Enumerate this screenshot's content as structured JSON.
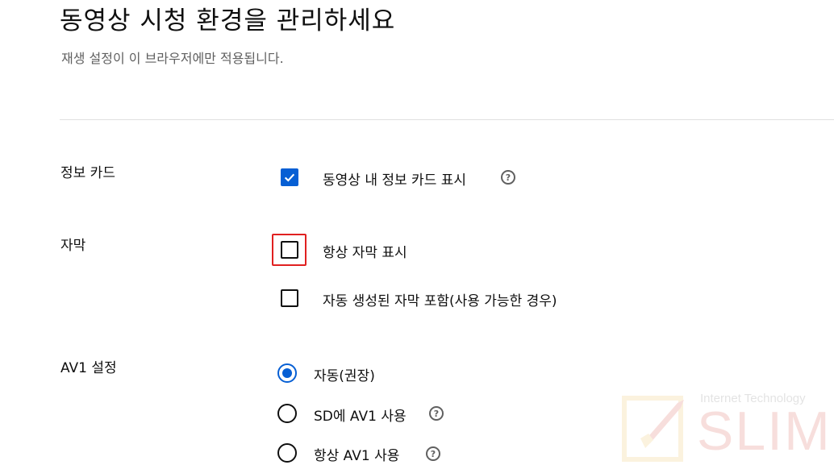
{
  "header": {
    "title": "동영상 시청 환경을 관리하세요",
    "subtitle": "재생 설정이 이 브라우저에만 적용됩니다."
  },
  "info_cards": {
    "label": "정보 카드",
    "option_label": "동영상 내 정보 카드 표시",
    "checked": true
  },
  "captions": {
    "label": "자막",
    "options": [
      {
        "label": "항상 자막 표시",
        "checked": false
      },
      {
        "label": "자동 생성된 자막 포함(사용 가능한 경우)",
        "checked": false
      }
    ]
  },
  "av1": {
    "label": "AV1 설정",
    "options": [
      {
        "label": "자동(권장)",
        "selected": true
      },
      {
        "label": "SD에 AV1 사용",
        "selected": false
      },
      {
        "label": "항상 AV1 사용",
        "selected": false
      }
    ]
  },
  "help_icon_glyph": "?",
  "watermark": {
    "tagline": "Internet Technology",
    "brand": "SLIM"
  },
  "colors": {
    "accent": "#065fd4",
    "highlight": "#e02020",
    "secondary_text": "#606060"
  }
}
